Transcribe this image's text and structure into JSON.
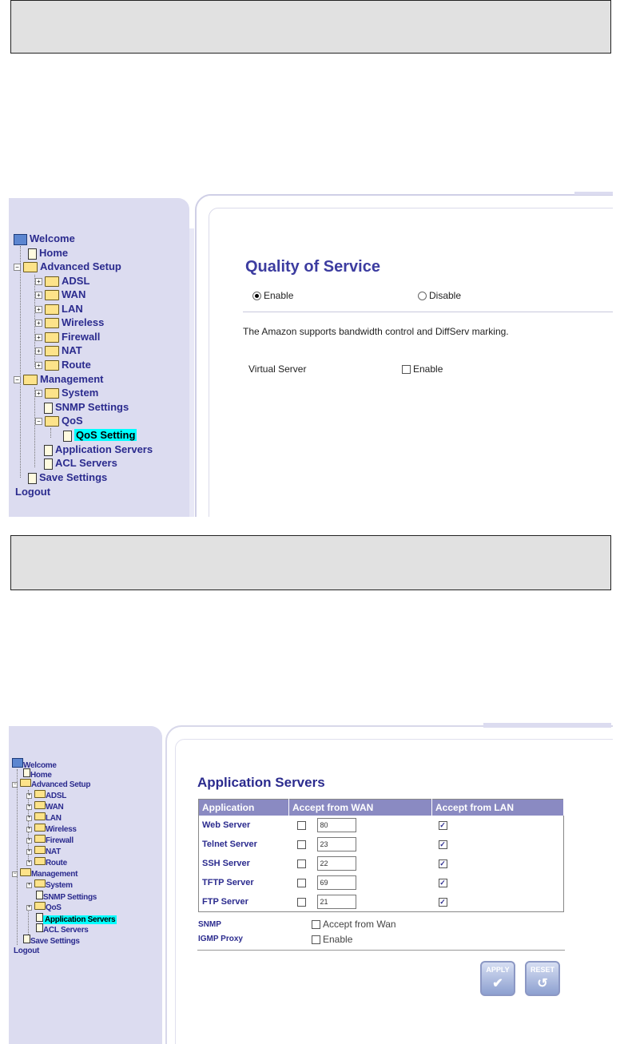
{
  "screenshot1": {
    "tree": {
      "welcome": "Welcome",
      "home": "Home",
      "advanced_setup": "Advanced Setup",
      "adsl": "ADSL",
      "wan": "WAN",
      "lan": "LAN",
      "wireless": "Wireless",
      "firewall": "Firewall",
      "nat": "NAT",
      "route": "Route",
      "management": "Management",
      "system": "System",
      "snmp_settings": "SNMP Settings",
      "qos": "QoS",
      "qos_setting": "QoS Setting",
      "application_servers": "Application Servers",
      "acl_servers": "ACL Servers",
      "save_settings": "Save Settings",
      "logout": "Logout"
    },
    "title": "Quality of Service",
    "enable_label": "Enable",
    "disable_label": "Disable",
    "selected": "Enable",
    "description": "The Amazon supports bandwidth control and DiffServ marking.",
    "virtual_server_label": "Virtual Server",
    "virtual_server_enable_label": "Enable"
  },
  "screenshot2": {
    "tree": {
      "welcome": "Welcome",
      "home": "Home",
      "advanced_setup": "Advanced Setup",
      "adsl": "ADSL",
      "wan": "WAN",
      "lan": "LAN",
      "wireless": "Wireless",
      "firewall": "Firewall",
      "nat": "NAT",
      "route": "Route",
      "management": "Management",
      "system": "System",
      "snmp_settings": "SNMP Settings",
      "qos": "QoS",
      "application_servers": "Application Servers",
      "acl_servers": "ACL Servers",
      "save_settings": "Save Settings",
      "logout": "Logout"
    },
    "title": "Application Servers",
    "table": {
      "headers": [
        "Application",
        "Accept from WAN",
        "Accept from LAN"
      ],
      "rows": [
        {
          "name": "Web Server",
          "wan_checked": false,
          "port": "80",
          "lan_checked": true
        },
        {
          "name": "Telnet Server",
          "wan_checked": false,
          "port": "23",
          "lan_checked": true
        },
        {
          "name": "SSH Server",
          "wan_checked": false,
          "port": "22",
          "lan_checked": true
        },
        {
          "name": "TFTP Server",
          "wan_checked": false,
          "port": "69",
          "lan_checked": true
        },
        {
          "name": "FTP Server",
          "wan_checked": false,
          "port": "21",
          "lan_checked": true
        }
      ]
    },
    "snmp_label": "SNMP",
    "snmp_option": "Accept from Wan",
    "igmp_label": "IGMP Proxy",
    "igmp_option": "Enable",
    "apply_label": "APPLY",
    "reset_label": "RESET"
  }
}
